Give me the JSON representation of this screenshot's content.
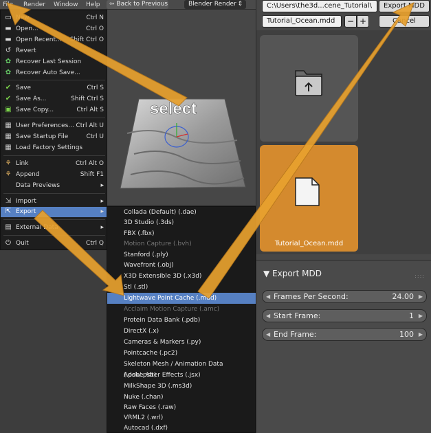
{
  "topbar": {
    "menus": [
      "File",
      "Render",
      "Window",
      "Help"
    ],
    "back_button": "Back to Previous",
    "render_engine": "Blender Render"
  },
  "viewport": {
    "annotation": "select"
  },
  "file_menu": {
    "items": [
      {
        "label": "New",
        "shortcut": "Ctrl N",
        "icon": "new-file-icon"
      },
      {
        "label": "Open...",
        "shortcut": "Ctrl O",
        "icon": "folder-open-icon"
      },
      {
        "label": "Open Recent...",
        "shortcut": "Shift Ctrl O",
        "icon": "recent-folder-icon"
      },
      {
        "label": "Revert",
        "shortcut": "",
        "icon": "revert-icon"
      },
      {
        "label": "Recover Last Session",
        "shortcut": "",
        "icon": "recover-icon"
      },
      {
        "label": "Recover Auto Save...",
        "shortcut": "",
        "icon": "recover-auto-icon"
      },
      {
        "label": "Save",
        "shortcut": "Ctrl S",
        "icon": "save-check-icon"
      },
      {
        "label": "Save As...",
        "shortcut": "Shift Ctrl S",
        "icon": "save-as-icon"
      },
      {
        "label": "Save Copy...",
        "shortcut": "Ctrl Alt S",
        "icon": "save-copy-icon"
      },
      {
        "label": "User Preferences...",
        "shortcut": "Ctrl Alt U",
        "icon": "preferences-icon"
      },
      {
        "label": "Save Startup File",
        "shortcut": "Ctrl U",
        "icon": "save-startup-icon"
      },
      {
        "label": "Load Factory Settings",
        "shortcut": "",
        "icon": "factory-settings-icon"
      },
      {
        "label": "Link",
        "shortcut": "Ctrl Alt O",
        "icon": "link-icon"
      },
      {
        "label": "Append",
        "shortcut": "Shift F1",
        "icon": "append-icon"
      },
      {
        "label": "Data Previews",
        "shortcut": "▸",
        "icon": ""
      },
      {
        "label": "Import",
        "shortcut": "▸",
        "icon": "import-icon"
      },
      {
        "label": "Export",
        "shortcut": "▸",
        "icon": "export-icon"
      },
      {
        "label": "External Data",
        "shortcut": "▸",
        "icon": "external-data-icon"
      },
      {
        "label": "Quit",
        "shortcut": "Ctrl Q",
        "icon": "quit-icon"
      }
    ]
  },
  "export_menu": {
    "items": [
      {
        "label": "Collada (Default) (.dae)",
        "state": "normal"
      },
      {
        "label": "3D Studio (.3ds)",
        "state": "normal"
      },
      {
        "label": "FBX (.fbx)",
        "state": "normal"
      },
      {
        "label": "Motion Capture (.bvh)",
        "state": "disabled"
      },
      {
        "label": "Stanford (.ply)",
        "state": "normal"
      },
      {
        "label": "Wavefront (.obj)",
        "state": "normal"
      },
      {
        "label": "X3D Extensible 3D (.x3d)",
        "state": "normal"
      },
      {
        "label": "Stl (.stl)",
        "state": "normal"
      },
      {
        "label": "Lightwave Point Cache (.mdd)",
        "state": "active"
      },
      {
        "label": "Acclaim Motion Capture (.amc)",
        "state": "disabled"
      },
      {
        "label": "Protein Data Bank (.pdb)",
        "state": "normal"
      },
      {
        "label": "DirectX (.x)",
        "state": "normal"
      },
      {
        "label": "Cameras & Markers (.py)",
        "state": "normal"
      },
      {
        "label": "Pointcache (.pc2)",
        "state": "normal"
      },
      {
        "label": "Skeleton Mesh / Animation Data (.psk/.psa)",
        "state": "normal"
      },
      {
        "label": "Adobe After Effects (.jsx)",
        "state": "normal"
      },
      {
        "label": "MilkShape 3D (.ms3d)",
        "state": "normal"
      },
      {
        "label": "Nuke (.chan)",
        "state": "normal"
      },
      {
        "label": "Raw Faces (.raw)",
        "state": "normal"
      },
      {
        "label": "VRML2 (.wrl)",
        "state": "normal"
      },
      {
        "label": "Autocad (.dxf)",
        "state": "normal"
      }
    ]
  },
  "file_browser": {
    "path": "C:\\Users\\the3d...cene_Tutorial\\",
    "export_button": "Export MDD",
    "filename": "Tutorial_Ocean.mdd",
    "minus": "−",
    "plus": "+",
    "cancel_button": "Cancel",
    "selected_file_label": "Tutorial_Ocean.mdd"
  },
  "export_props": {
    "header": "▼ Export MDD",
    "fields": [
      {
        "label": "Frames Per Second:",
        "value": "24.00"
      },
      {
        "label": "Start Frame:",
        "value": "1"
      },
      {
        "label": "End Frame:",
        "value": "100"
      }
    ]
  },
  "colors": {
    "accent_highlight": "#5680c2",
    "selected_tile": "#d48a2e",
    "arrow_annotation": "#e8a12e"
  }
}
